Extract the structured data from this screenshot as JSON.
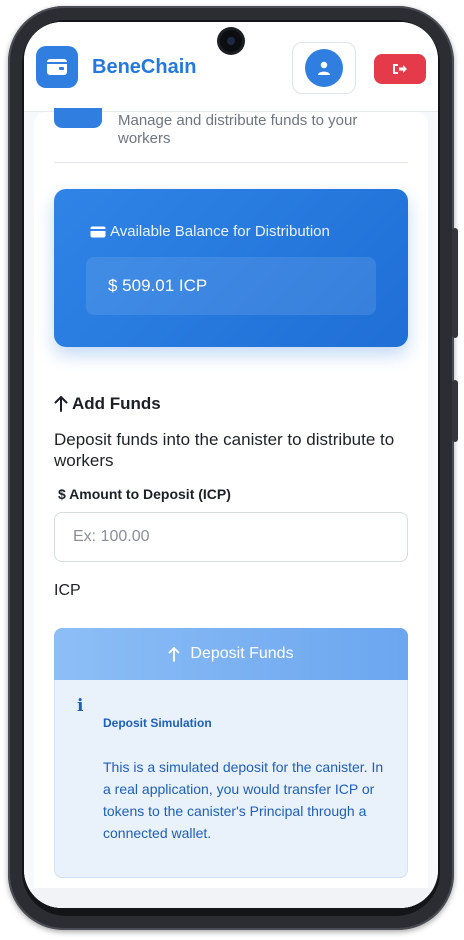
{
  "app": {
    "brand": "BeneChain"
  },
  "page": {
    "subtitle": "Manage and distribute funds to your workers"
  },
  "balance": {
    "label": "Available Balance for Distribution",
    "amount": "$ 509.01 ICP"
  },
  "add_funds": {
    "title": "Add Funds",
    "description": "Deposit funds into the canister to distribute to workers",
    "amount_label": "$ Amount to Deposit (ICP)",
    "amount_placeholder": "Ex: 100.00",
    "unit": "ICP",
    "button_label": "Deposit Funds"
  },
  "info": {
    "icon_glyph": "i",
    "title": "Deposit Simulation",
    "text": "This is a simulated deposit for the canister. In a real application, you would transfer ICP or tokens to the canister's Principal through a connected wallet."
  },
  "icons": {
    "logo": "wallet-icon",
    "avatar": "user-icon",
    "logout": "logout-icon",
    "balance": "card-icon",
    "add_funds": "arrow-up-icon",
    "deposit": "arrow-up-icon"
  },
  "colors": {
    "accent": "#2f7ee0",
    "brand_text": "#2579de",
    "logout": "#e43a4a",
    "info_text": "#1f5fb8",
    "info_bg": "#e9f1fb"
  }
}
